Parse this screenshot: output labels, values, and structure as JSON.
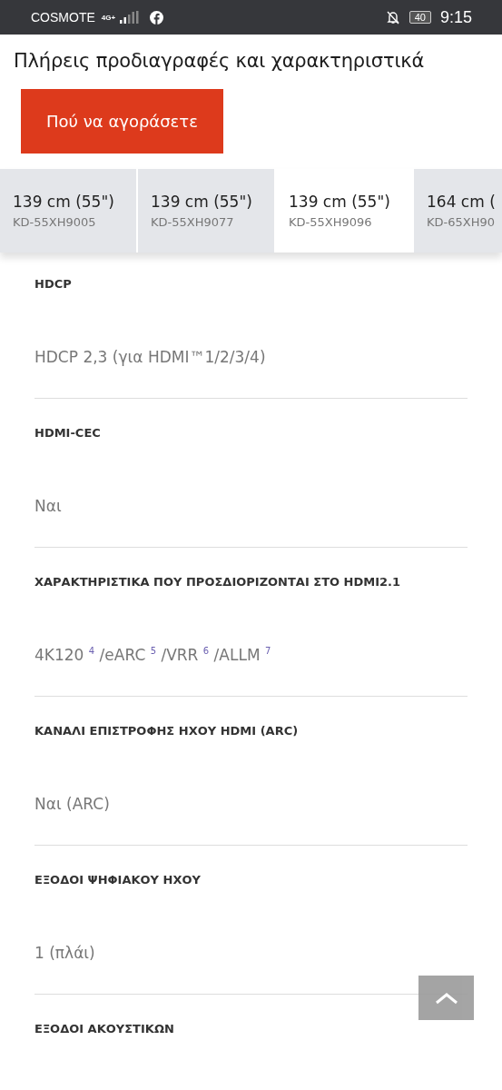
{
  "status_bar": {
    "carrier": "COSMOTE",
    "network": "4G+",
    "battery": "40",
    "time": "9:15"
  },
  "title": "Πλήρεις προδιαγραφές και χαρακτηριστικά",
  "buy_button": "Πού να αγοράσετε",
  "models": [
    {
      "size": "139 cm (55\")",
      "model": "KD-55XH9005",
      "selected": false
    },
    {
      "size": "139 cm (55\")",
      "model": "KD-55XH9077",
      "selected": false
    },
    {
      "size": "139 cm (55\")",
      "model": "KD-55XH9096",
      "selected": true
    },
    {
      "size": "164 cm (",
      "model": "KD-65XH90",
      "selected": false
    }
  ],
  "specs": [
    {
      "label": "HDCP",
      "value": "HDCP 2,3 (για HDMI™1/2/3/4)"
    },
    {
      "label": "HDMI-CEC",
      "value": "Ναι"
    },
    {
      "label": "ΧΑΡΑΚΤΗΡΙΣΤΙΚΑ ΠΟΥ ΠΡΟΣΔΙΟΡΙΖΟΝΤΑΙ ΣΤΟ HDMI2.1",
      "value": "4K120 $^{4}$  /eARC $^{5}$  /VRR $^{6}$  /ALLM $^{7}$"
    },
    {
      "label": "ΚΑΝΑΛΙ ΕΠΙΣΤΡΟΦΗΣ ΗΧΟΥ HDMI (ARC)",
      "value": "Ναι (ARC)"
    },
    {
      "label": "ΕΞΟΔΟΙ ΨΗΦΙΑΚΟΥ ΗΧΟΥ",
      "value": "1 (πλάι)"
    },
    {
      "label": "ΕΞΟΔΟΙ ΑΚΟΥΣΤΙΚΩΝ"
    }
  ]
}
